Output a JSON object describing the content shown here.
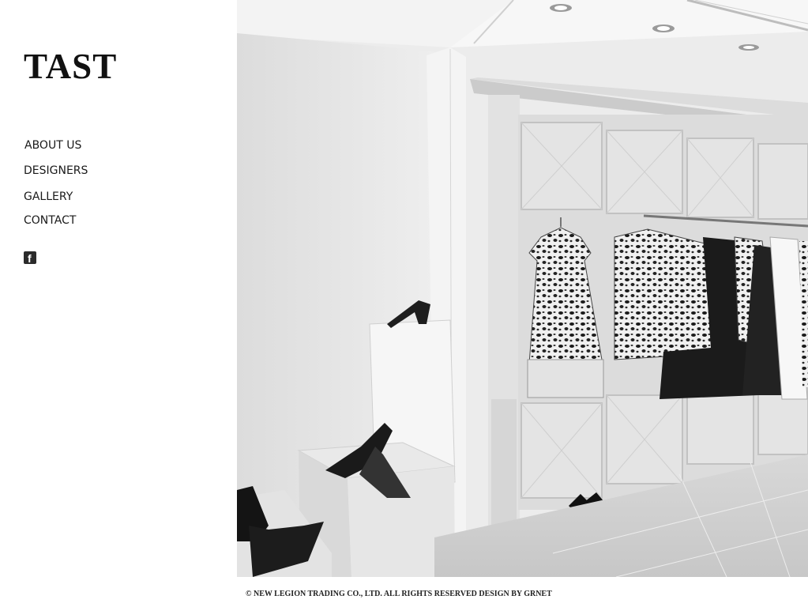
{
  "brand": {
    "logo_text": "TAST"
  },
  "nav": {
    "items": [
      {
        "label": "ABOUT US"
      },
      {
        "label": "DESIGNERS"
      },
      {
        "label": "GALLERY"
      },
      {
        "label": "CONTACT"
      }
    ]
  },
  "social": {
    "facebook_glyph": "f",
    "facebook_icon": "facebook-icon"
  },
  "footer": {
    "text": "© NEW LEGION TRADING CO., LTD. ALL RIGHTS RESERVED    DESIGN BY GRNET"
  },
  "colors": {
    "text": "#111111",
    "background": "#ffffff"
  }
}
